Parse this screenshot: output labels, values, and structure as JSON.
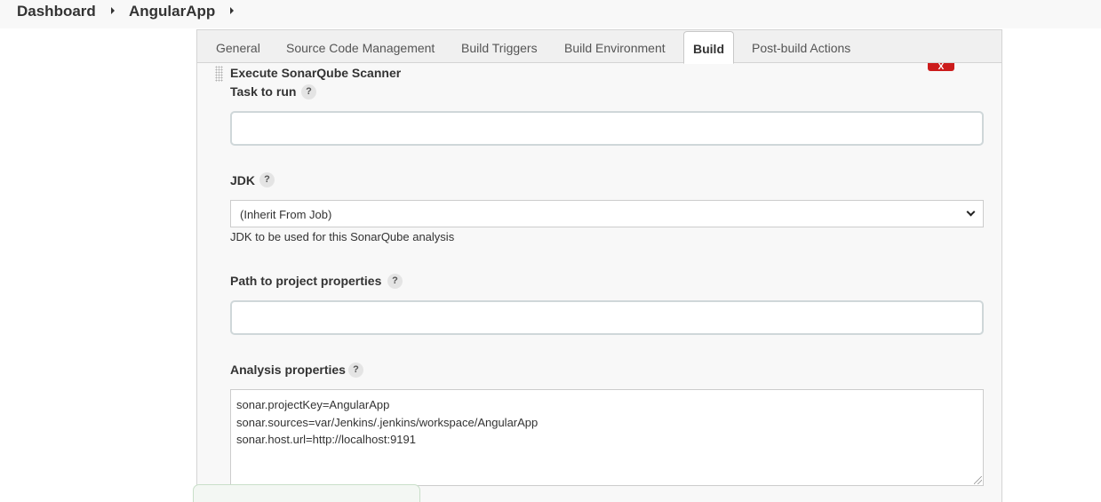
{
  "breadcrumb": {
    "items": [
      "Dashboard",
      "AngularApp"
    ]
  },
  "tabs": [
    "General",
    "Source Code Management",
    "Build Triggers",
    "Build Environment",
    "Build",
    "Post-build Actions"
  ],
  "active_tab": "Build",
  "build_step": {
    "title": "Execute SonarQube Scanner",
    "delete_label": "X",
    "fields": {
      "task": {
        "label": "Task to run",
        "help": "?",
        "value": ""
      },
      "jdk": {
        "label": "JDK",
        "help": "?",
        "selected": "(Inherit From Job)",
        "description": "JDK to be used for this SonarQube analysis"
      },
      "path": {
        "label": "Path to project properties",
        "help": "?",
        "value": ""
      },
      "analysis": {
        "label": "Analysis properties",
        "help": "?",
        "lines": [
          "sonar.projectKey=AngularApp",
          "sonar.sources=var/Jenkins/.jenkins/workspace/AngularApp",
          "sonar.host.url=http://localhost:9191"
        ]
      }
    }
  },
  "icons": {
    "breadcrumb_separator": "caret-right-icon",
    "drag_handle": "drag-handle-icon",
    "help": "question-mark-icon",
    "select": "chevron-down-icon",
    "resize": "resize-grip-icon"
  },
  "colors": {
    "delete_button": "#cc1c1c",
    "active_tab_bg": "#ffffff",
    "frame_bg": "#f8f8f8"
  }
}
